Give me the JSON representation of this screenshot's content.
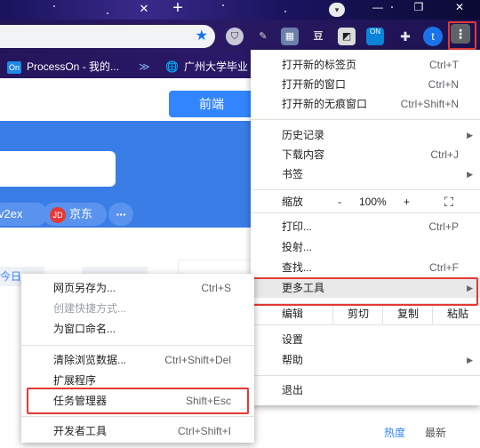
{
  "chrome": {
    "tab_close_glyph": "✕",
    "new_tab_glyph": "+",
    "tab_search_glyph": "▾",
    "window_minimize": "—",
    "window_maximize": "❐",
    "window_close": "✕",
    "bookmark_star_glyph": "★",
    "extensions": [
      {
        "name": "shield-ext-icon",
        "glyph": "⛉"
      },
      {
        "name": "pen-ext-icon",
        "glyph": "✎"
      },
      {
        "name": "image-ext-icon",
        "glyph": "▦"
      },
      {
        "name": "bean-ext-icon",
        "glyph": "豆"
      },
      {
        "name": "dict-ext-icon",
        "glyph": "◩"
      },
      {
        "name": "on-ext-icon",
        "glyph": "ON"
      },
      {
        "name": "puzzle-ext-icon",
        "glyph": "✚"
      }
    ],
    "avatar_letter": "t",
    "menu_button_glyph": "⋮"
  },
  "bookmarks": [
    {
      "icon": "On",
      "label": "ProcessOn - 我的..."
    },
    {
      "icon": "≫",
      "label": ""
    },
    {
      "icon": "🌐",
      "label": "广州大学毕业"
    }
  ],
  "page": {
    "tab_front": "前端",
    "pill_v2ex": "v2ex",
    "pill_jd_badge": "JD",
    "pill_jd": "京东",
    "pill_more": "···",
    "strip_text": "今日",
    "sort_hot": "热度",
    "sort_new": "最新"
  },
  "menu": {
    "new_tab": {
      "label": "打开新的标签页",
      "key": "Ctrl+T"
    },
    "new_window": {
      "label": "打开新的窗口",
      "key": "Ctrl+N"
    },
    "incognito": {
      "label": "打开新的无痕窗口",
      "key": "Ctrl+Shift+N"
    },
    "history": {
      "label": "历史记录"
    },
    "downloads": {
      "label": "下载内容",
      "key": "Ctrl+J"
    },
    "bookmarks": {
      "label": "书签"
    },
    "zoom": {
      "label": "缩放",
      "minus": "-",
      "value": "100%",
      "plus": "+",
      "fullscreen": "⛶"
    },
    "print": {
      "label": "打印...",
      "key": "Ctrl+P"
    },
    "cast": {
      "label": "投射..."
    },
    "find": {
      "label": "查找...",
      "key": "Ctrl+F"
    },
    "more_tools": {
      "label": "更多工具"
    },
    "edit": {
      "label": "编辑",
      "cut": "剪切",
      "copy": "复制",
      "paste": "粘贴"
    },
    "settings": {
      "label": "设置"
    },
    "help": {
      "label": "帮助"
    },
    "exit": {
      "label": "退出"
    },
    "arrow": "▶"
  },
  "submenu": {
    "save_page": {
      "label": "网页另存为...",
      "key": "Ctrl+S"
    },
    "create_shortcut": {
      "label": "创建快捷方式..."
    },
    "name_window": {
      "label": "为窗口命名..."
    },
    "clear_data": {
      "label": "清除浏览数据...",
      "key": "Ctrl+Shift+Del"
    },
    "extensions": {
      "label": "扩展程序"
    },
    "task_manager": {
      "label": "任务管理器",
      "key": "Shift+Esc"
    },
    "dev_tools": {
      "label": "开发者工具",
      "key": "Ctrl+Shift+I"
    }
  }
}
